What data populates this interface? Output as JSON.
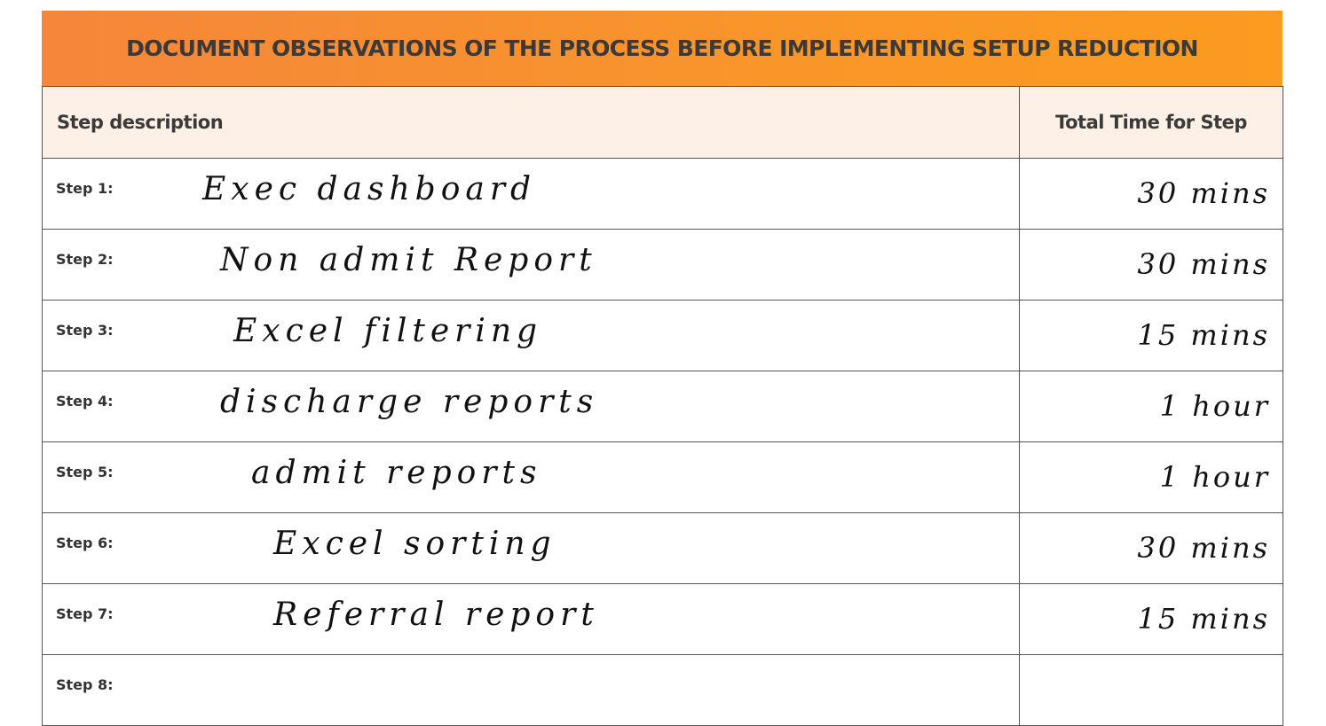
{
  "title": "DOCUMENT OBSERVATIONS OF THE PROCESS BEFORE IMPLEMENTING SETUP REDUCTION",
  "headers": {
    "step": "Step description",
    "time": "Total Time for Step"
  },
  "rows": [
    {
      "label": "Step 1:",
      "description": "Exec dashboard",
      "time": "30 mins"
    },
    {
      "label": "Step 2:",
      "description": "Non admit Report",
      "time": "30 mins"
    },
    {
      "label": "Step 3:",
      "description": "Excel filtering",
      "time": "15 mins"
    },
    {
      "label": "Step 4:",
      "description": "discharge reports",
      "time": "1 hour"
    },
    {
      "label": "Step 5:",
      "description": "admit reports",
      "time": "1 hour"
    },
    {
      "label": "Step 6:",
      "description": "Excel sorting",
      "time": "30 mins"
    },
    {
      "label": "Step 7:",
      "description": "Referral report",
      "time": "15 mins"
    },
    {
      "label": "Step 8:",
      "description": "",
      "time": ""
    }
  ]
}
